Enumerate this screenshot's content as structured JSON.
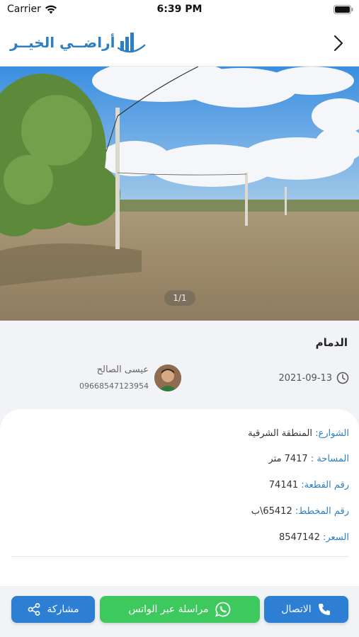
{
  "status_bar": {
    "carrier": "Carrier",
    "time": "6:39 PM"
  },
  "header": {
    "logo_text": "أراضــي الخيــر"
  },
  "gallery": {
    "indicator": "1/1"
  },
  "listing": {
    "city": "الدمام",
    "date": "2021-09-13",
    "agent_name": "عيسى الصالح",
    "agent_phone": "09668547123954"
  },
  "details": {
    "street_label": "الشوارع:",
    "street_value": "المنطقة الشرقية",
    "area_label": "المساحة :",
    "area_value": "7417 متر",
    "plot_label": "رقم القطعة:",
    "plot_value": "74141",
    "plan_label": "رقم المخطط:",
    "plan_value": "65412\\ب",
    "price_label": "السعر:",
    "price_value": "8547142"
  },
  "actions": {
    "call_label": "الاتصال",
    "whatsapp_label": "مراسلة عبر الواتس",
    "share_label": "مشاركة"
  },
  "colors": {
    "brand_blue": "#2d7fc1",
    "button_blue": "#2d7fd4",
    "whatsapp_green": "#3ec95f"
  }
}
